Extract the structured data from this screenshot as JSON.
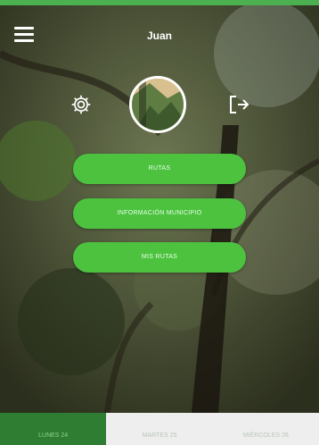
{
  "header": {
    "username": "Juan",
    "menu_icon": "hamburger-menu-icon",
    "settings_icon": "gear-icon",
    "logout_icon": "logout-icon",
    "avatar_alt": "profile-photo"
  },
  "menu": {
    "buttons": [
      {
        "label": "RUTAS"
      },
      {
        "label": "INFORMACIÓN MUNICIPIO"
      },
      {
        "label": "MIS RUTAS"
      }
    ]
  },
  "tabs": [
    {
      "label": "LUNES 24",
      "active": true
    },
    {
      "label": "MARTES 25",
      "active": false
    },
    {
      "label": "MIÉRCOLES 26",
      "active": false
    }
  ],
  "colors": {
    "accent": "#4cc23f",
    "tab_active": "#2e7d32",
    "tab_inactive": "#eeeeee"
  }
}
